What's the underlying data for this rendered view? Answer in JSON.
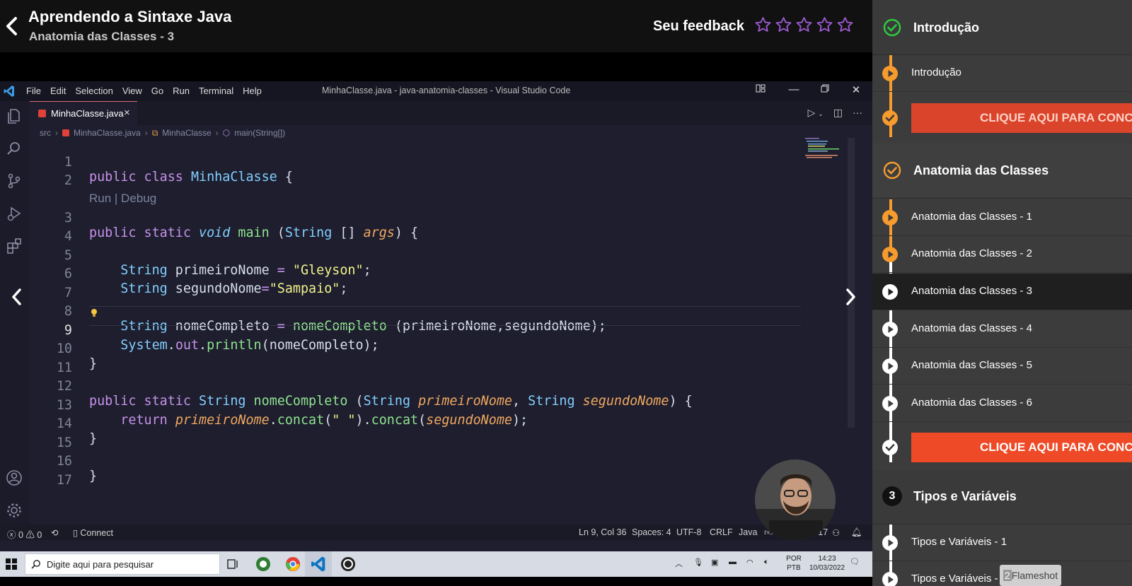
{
  "header": {
    "course_title": "Aprendendo a Sintaxe Java",
    "lesson_subtitle": "Anatomia das Classes - 3",
    "feedback_label": "Seu feedback",
    "star_count": 5,
    "star_color": "#9b59d0"
  },
  "vscode": {
    "menu": [
      "File",
      "Edit",
      "Selection",
      "View",
      "Go",
      "Run",
      "Terminal",
      "Help"
    ],
    "window_title": "MinhaClasse.java - java-anatomia-classes - Visual Studio Code",
    "tab_label": "MinhaClasse.java",
    "tab_close": "×",
    "breadcrumb": {
      "src": "src",
      "file": "MinhaClasse.java",
      "class": "MinhaClasse",
      "method": "main(String[])"
    },
    "codelens": "Run | Debug",
    "line_numbers": [
      "1",
      "2",
      "3",
      "4",
      "5",
      "6",
      "7",
      "8",
      "9",
      "10",
      "11",
      "12",
      "13",
      "14",
      "15",
      "16",
      "17"
    ],
    "code": {
      "l1": {
        "a": "public",
        "b": " class ",
        "c": "MinhaClasse",
        "d": " {"
      },
      "l3": {
        "a": "public",
        "b": " ",
        "c": "static",
        "d": " ",
        "e": "void",
        "f": " ",
        "g": "main",
        "h": " (",
        "i": "String",
        "j": " [] ",
        "k": "args",
        "l": ") {"
      },
      "l5": {
        "a": "    ",
        "b": "String",
        "c": " primeiroNome ",
        "d": "=",
        "e": " ",
        "f": "\"Gleyson\"",
        "g": ";"
      },
      "l6": {
        "a": "    ",
        "b": "String",
        "c": " segundoNome",
        "d": "=",
        "e": "\"Sampaio\"",
        "f": ";"
      },
      "l8": {
        "a": "    ",
        "b": "String",
        "c": " nomeCompleto ",
        "d": "=",
        "e": " ",
        "f": "nomeCompleto",
        "g": " (primeiroNome,segundoNome);"
      },
      "l9": {
        "a": "    ",
        "b": "System",
        "c": ".",
        "d": "out",
        "e": ".",
        "f": "println",
        "g": "(nomeCompleto);"
      },
      "l10": "}",
      "l12": {
        "a": "public",
        "b": " ",
        "c": "static",
        "d": " ",
        "e": "String",
        "f": " ",
        "g": "nomeCompleto",
        "h": " (",
        "i": "String",
        "j": " ",
        "k": "primeiroNome",
        "l": ", ",
        "m": "String",
        "n": " ",
        "o": "segundoNome",
        "p": ") {"
      },
      "l13": {
        "a": "    ",
        "b": "return",
        "c": " ",
        "d": "primeiroNome",
        "e": ".",
        "f": "concat",
        "g": "(",
        "h": "\" \"",
        "i": ").",
        "j": "concat",
        "k": "(",
        "l": "segundoNome",
        "m": ");"
      },
      "l14": "}",
      "l16": "}"
    },
    "status": {
      "errors": "0",
      "warnings": "0",
      "connect": "Connect",
      "position": "Ln 9, Col 36",
      "spaces": "Spaces: 4",
      "encoding": "UTF-8",
      "eol": "CRLF",
      "language": "Java",
      "jdk": "JavaSE-17"
    },
    "colors": {
      "keyword": "#c792ea",
      "type": "#82cfff",
      "function": "#8fe38f",
      "string": "#f1f28c",
      "param": "#f0a860"
    }
  },
  "taskbar": {
    "search_placeholder": "Digite aqui para pesquisar",
    "lang_top": "POR",
    "lang_bottom": "PTB",
    "time": "14:23",
    "date": "10/03/2022"
  },
  "course_panel": {
    "accent": "#f79b2e",
    "sections": [
      {
        "title": "Introdução",
        "badge": "check-circle-green"
      },
      {
        "title": "Anatomia das Classes",
        "badge": "check-circle-orange"
      },
      {
        "title": "Tipos e Variáveis",
        "badge": "3"
      }
    ],
    "intro_lessons": [
      "Introdução"
    ],
    "intro_cta": "CLIQUE AQUI PARA CONC",
    "anatomia_lessons": [
      "Anatomia das Classes - 1",
      "Anatomia das Classes - 2",
      "Anatomia das Classes - 3",
      "Anatomia das Classes - 4",
      "Anatomia das Classes - 5",
      "Anatomia das Classes - 6"
    ],
    "anatomia_cta": "CLIQUE AQUI PARA CONC",
    "tipos_lessons": [
      "Tipos e Variáveis - 1",
      "Tipos e Variáveis - 2"
    ]
  },
  "overlay": {
    "flameshot_count": "2",
    "flameshot_label": "Flameshot"
  }
}
